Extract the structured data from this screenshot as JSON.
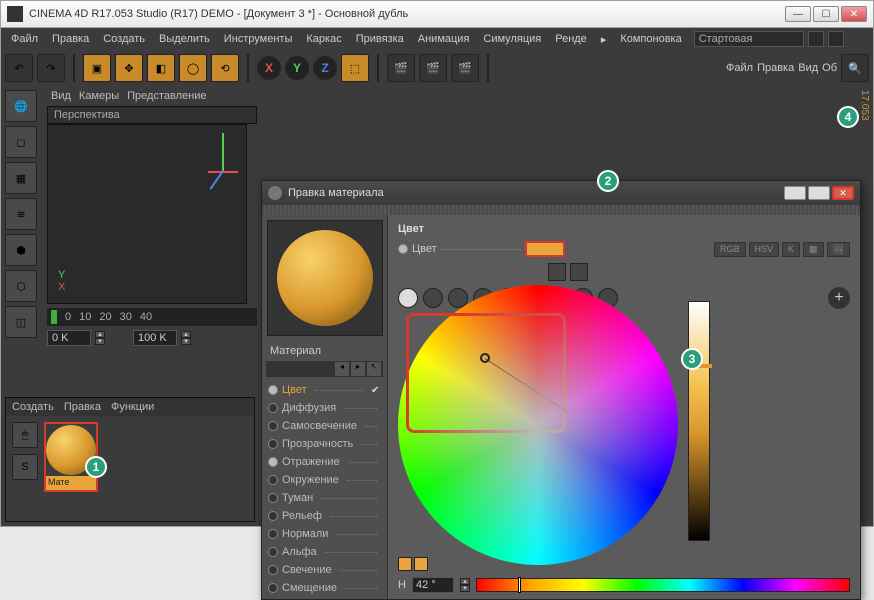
{
  "window": {
    "title": "CINEMA 4D R17.053 Studio (R17) DEMO - [Документ 3 *] - Основной дубль"
  },
  "menus": {
    "file": "Файл",
    "edit": "Правка",
    "create": "Создать",
    "select": "Выделить",
    "tools": "Инструменты",
    "wire": "Каркас",
    "snap": "Привязка",
    "anim": "Анимация",
    "sim": "Симуляция",
    "render": "Ренде",
    "arrow": "▸",
    "layout": "Компоновка",
    "layout_value": "Стартовая"
  },
  "secondary_menu": {
    "file": "Файл",
    "edit": "Правка",
    "view": "Вид",
    "obj": "Об"
  },
  "viewport": {
    "tabs": {
      "view": "Вид",
      "cameras": "Камеры",
      "display": "Представление"
    },
    "title": "Перспектива",
    "axis_y": "Y",
    "axis_x": "X"
  },
  "timeline": {
    "t0": "0",
    "t10": "10",
    "t20": "20",
    "t30": "30",
    "t40": "40"
  },
  "timefields": {
    "start": "0 K",
    "end": "100 K"
  },
  "materials_panel": {
    "tabs": {
      "create": "Создать",
      "edit": "Правка",
      "func": "Функции"
    },
    "thumb_label": "Мате"
  },
  "material_editor": {
    "title": "Правка материала",
    "preview_label": "Материал",
    "channels": {
      "color": "Цвет",
      "diffuse": "Диффузия",
      "lumin": "Самосвечение",
      "trans": "Прозрачность",
      "refl": "Отражение",
      "env": "Окружение",
      "fog": "Туман",
      "bump": "Рельеф",
      "normal": "Нормали",
      "alpha": "Альфа",
      "glow": "Свечение",
      "disp": "Смещение"
    },
    "main": {
      "header": "Цвет",
      "color_label": "Цвет",
      "mode_rgb": "RGB",
      "mode_hsv": "HSV",
      "mode_k": "K",
      "hue_label": "H",
      "hue_value": "42 °"
    }
  },
  "axes": {
    "x": "X",
    "y": "Y",
    "z": "Z"
  },
  "badges": {
    "b1": "1",
    "b2": "2",
    "b3": "3",
    "b4": "4"
  },
  "right_label": "17.053"
}
